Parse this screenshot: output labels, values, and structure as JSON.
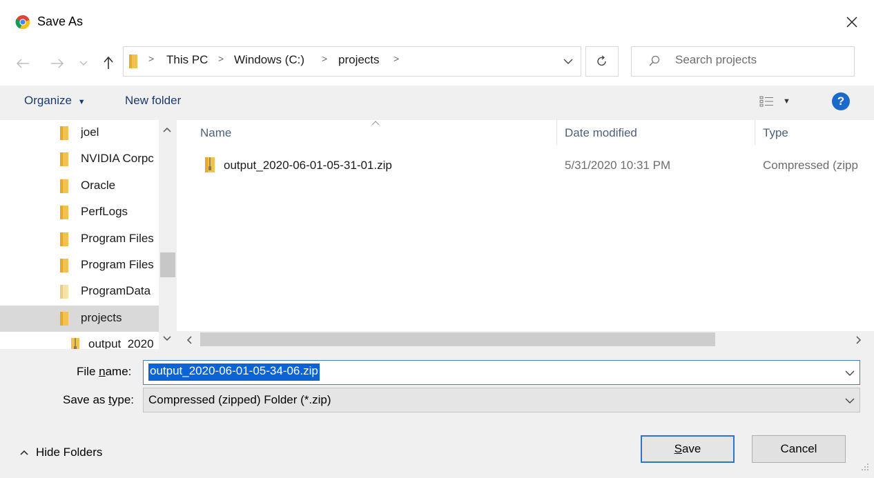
{
  "window": {
    "title": "Save As"
  },
  "nav": {
    "breadcrumbs": [
      "This PC",
      "Windows (C:)",
      "projects"
    ],
    "search_placeholder": "Search projects"
  },
  "toolbar": {
    "organize_label": "Organize",
    "new_folder_label": "New folder"
  },
  "navpane": {
    "items": [
      {
        "label": "joel"
      },
      {
        "label": "NVIDIA Corpc"
      },
      {
        "label": "Oracle"
      },
      {
        "label": "PerfLogs"
      },
      {
        "label": "Program Files"
      },
      {
        "label": "Program Files"
      },
      {
        "label": "ProgramData"
      },
      {
        "label": "projects",
        "selected": true
      },
      {
        "label": "output_2020"
      }
    ]
  },
  "filelist": {
    "columns": [
      "Name",
      "Date modified",
      "Type"
    ],
    "rows": [
      {
        "name": "output_2020-06-01-05-31-01.zip",
        "date": "5/31/2020 10:31 PM",
        "type": "Compressed (zipp"
      }
    ]
  },
  "form": {
    "filename_label_pre": "File ",
    "filename_label_ul": "n",
    "filename_label_post": "ame:",
    "filename_value": "output_2020-06-01-05-34-06.zip",
    "savetype_label_pre": "Save as ",
    "savetype_label_ul": "t",
    "savetype_label_post": "ype:",
    "savetype_value": "Compressed (zipped) Folder (*.zip)"
  },
  "footer": {
    "hide_folders_label": "Hide Folders",
    "save_label_ul": "S",
    "save_label_rest": "ave",
    "cancel_label": "Cancel"
  },
  "colors": {
    "accent": "#0a64d6",
    "folder": "#f2c14e",
    "link": "#1a3a6e"
  }
}
